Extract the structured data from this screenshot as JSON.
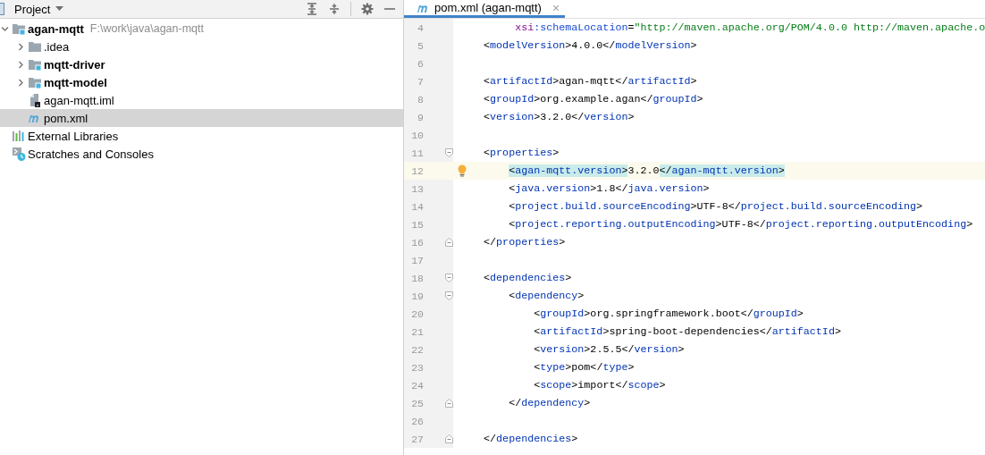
{
  "project_panel": {
    "title": "Project"
  },
  "tree": [
    {
      "kind": "module",
      "label": "agan-mqtt",
      "path": "F:\\work\\java\\agan-mqtt",
      "expanded": true,
      "selected": false,
      "children": [
        {
          "kind": "folder",
          "label": ".idea",
          "expanded": false,
          "selected": false
        },
        {
          "kind": "module-folder",
          "label": "mqtt-driver",
          "expanded": false,
          "selected": false
        },
        {
          "kind": "module-folder",
          "label": "mqtt-model",
          "expanded": false,
          "selected": false
        },
        {
          "kind": "iml",
          "label": "agan-mqtt.iml",
          "selected": false
        },
        {
          "kind": "maven",
          "label": "pom.xml",
          "selected": true
        }
      ]
    },
    {
      "kind": "libraries",
      "label": "External Libraries",
      "selected": false
    },
    {
      "kind": "scratches",
      "label": "Scratches and Consoles",
      "selected": false
    }
  ],
  "tabs": [
    {
      "label": "pom.xml (agan-mqtt)",
      "close": "×",
      "selected": true
    }
  ],
  "editor": {
    "lines": [
      {
        "number": "4",
        "kind": "continuation",
        "current": false,
        "intention": false,
        "tokens": [
          {
            "kind": "ns",
            "text": "xsi"
          },
          {
            "kind": "attr",
            "text": ":schemaLocation"
          },
          {
            "kind": "plain",
            "text": "="
          },
          {
            "kind": "string",
            "text": "\"http://maven.apache.org/POM/4.0.0 http://maven.apache.o"
          }
        ]
      },
      {
        "number": "5",
        "kind": "plain",
        "current": false,
        "intention": false,
        "tokens": [
          {
            "kind": "plain",
            "text": "<"
          },
          {
            "kind": "tag",
            "text": "modelVersion"
          },
          {
            "kind": "plain",
            "text": ">4.0.0</"
          },
          {
            "kind": "tag",
            "text": "modelVersion"
          },
          {
            "kind": "plain",
            "text": ">"
          }
        ]
      },
      {
        "number": "6",
        "kind": "plain",
        "current": false,
        "intention": false
      },
      {
        "number": "7",
        "kind": "plain",
        "current": false,
        "intention": false,
        "tokens": [
          {
            "kind": "plain",
            "text": "<"
          },
          {
            "kind": "tag",
            "text": "artifactId"
          },
          {
            "kind": "plain",
            "text": ">agan-mqtt</"
          },
          {
            "kind": "tag",
            "text": "artifactId"
          },
          {
            "kind": "plain",
            "text": ">"
          }
        ]
      },
      {
        "number": "8",
        "kind": "plain",
        "current": false,
        "intention": false,
        "tokens": [
          {
            "kind": "plain",
            "text": "<"
          },
          {
            "kind": "tag",
            "text": "groupId"
          },
          {
            "kind": "plain",
            "text": ">org.example.agan</"
          },
          {
            "kind": "tag",
            "text": "groupId"
          },
          {
            "kind": "plain",
            "text": ">"
          }
        ]
      },
      {
        "number": "9",
        "kind": "plain",
        "current": false,
        "intention": false,
        "tokens": [
          {
            "kind": "plain",
            "text": "<"
          },
          {
            "kind": "tag",
            "text": "version"
          },
          {
            "kind": "plain",
            "text": ">3.2.0</"
          },
          {
            "kind": "tag",
            "text": "version"
          },
          {
            "kind": "plain",
            "text": ">"
          }
        ]
      },
      {
        "number": "10",
        "kind": "plain",
        "current": false,
        "intention": false
      },
      {
        "number": "11",
        "kind": "fold-start",
        "current": false,
        "intention": false,
        "tokens": [
          {
            "kind": "plain",
            "text": "<"
          },
          {
            "kind": "tag",
            "text": "properties"
          },
          {
            "kind": "plain",
            "text": ">"
          }
        ],
        "children": [
          {
            "number": "12",
            "kind": "plain",
            "current": true,
            "intention": true,
            "tokens": [
              {
                "kind": "match-plain",
                "text": "<"
              },
              {
                "kind": "match-tag",
                "text": "agan-mqtt.version"
              },
              {
                "kind": "match-plain",
                "text": ">"
              },
              {
                "kind": "plain",
                "text": "3.2.0"
              },
              {
                "kind": "match-plain",
                "text": "</"
              },
              {
                "kind": "match-tag",
                "text": "agan-mqtt.version"
              },
              {
                "kind": "match-plain",
                "text": ">"
              }
            ]
          },
          {
            "number": "13",
            "kind": "plain",
            "current": false,
            "intention": false,
            "tokens": [
              {
                "kind": "plain",
                "text": "<"
              },
              {
                "kind": "tag",
                "text": "java.version"
              },
              {
                "kind": "plain",
                "text": ">1.8</"
              },
              {
                "kind": "tag",
                "text": "java.version"
              },
              {
                "kind": "plain",
                "text": ">"
              }
            ]
          },
          {
            "number": "14",
            "kind": "plain",
            "current": false,
            "intention": false,
            "tokens": [
              {
                "kind": "plain",
                "text": "<"
              },
              {
                "kind": "tag",
                "text": "project.build.sourceEncoding"
              },
              {
                "kind": "plain",
                "text": ">UTF-8</"
              },
              {
                "kind": "tag",
                "text": "project.build.sourceEncoding"
              },
              {
                "kind": "plain",
                "text": ">"
              }
            ]
          },
          {
            "number": "15",
            "kind": "plain",
            "current": false,
            "intention": false,
            "tokens": [
              {
                "kind": "plain",
                "text": "<"
              },
              {
                "kind": "tag",
                "text": "project.reporting.outputEncoding"
              },
              {
                "kind": "plain",
                "text": ">UTF-8</"
              },
              {
                "kind": "tag",
                "text": "project.reporting.outputEncoding"
              },
              {
                "kind": "plain",
                "text": ">"
              }
            ]
          }
        ]
      },
      {
        "number": "16",
        "kind": "fold-end",
        "current": false,
        "intention": false,
        "tokens": [
          {
            "kind": "plain",
            "text": "</"
          },
          {
            "kind": "tag",
            "text": "properties"
          },
          {
            "kind": "plain",
            "text": ">"
          }
        ]
      },
      {
        "number": "17",
        "kind": "plain",
        "current": false,
        "intention": false
      },
      {
        "number": "18",
        "kind": "fold-start",
        "current": false,
        "intention": false,
        "tokens": [
          {
            "kind": "plain",
            "text": "<"
          },
          {
            "kind": "tag",
            "text": "dependencies"
          },
          {
            "kind": "plain",
            "text": ">"
          }
        ],
        "children": [
          {
            "number": "19",
            "kind": "fold-start",
            "current": false,
            "intention": false,
            "tokens": [
              {
                "kind": "plain",
                "text": "<"
              },
              {
                "kind": "tag",
                "text": "dependency"
              },
              {
                "kind": "plain",
                "text": ">"
              }
            ],
            "children": [
              {
                "number": "20",
                "kind": "plain",
                "current": false,
                "intention": false,
                "tokens": [
                  {
                    "kind": "plain",
                    "text": "<"
                  },
                  {
                    "kind": "tag",
                    "text": "groupId"
                  },
                  {
                    "kind": "plain",
                    "text": ">org.springframework.boot</"
                  },
                  {
                    "kind": "tag",
                    "text": "groupId"
                  },
                  {
                    "kind": "plain",
                    "text": ">"
                  }
                ]
              },
              {
                "number": "21",
                "kind": "plain",
                "current": false,
                "intention": false,
                "tokens": [
                  {
                    "kind": "plain",
                    "text": "<"
                  },
                  {
                    "kind": "tag",
                    "text": "artifactId"
                  },
                  {
                    "kind": "plain",
                    "text": ">spring-boot-dependencies</"
                  },
                  {
                    "kind": "tag",
                    "text": "artifactId"
                  },
                  {
                    "kind": "plain",
                    "text": ">"
                  }
                ]
              },
              {
                "number": "22",
                "kind": "plain",
                "current": false,
                "intention": false,
                "tokens": [
                  {
                    "kind": "plain",
                    "text": "<"
                  },
                  {
                    "kind": "tag",
                    "text": "version"
                  },
                  {
                    "kind": "plain",
                    "text": ">2.5.5</"
                  },
                  {
                    "kind": "tag",
                    "text": "version"
                  },
                  {
                    "kind": "plain",
                    "text": ">"
                  }
                ]
              },
              {
                "number": "23",
                "kind": "plain",
                "current": false,
                "intention": false,
                "tokens": [
                  {
                    "kind": "plain",
                    "text": "<"
                  },
                  {
                    "kind": "tag",
                    "text": "type"
                  },
                  {
                    "kind": "plain",
                    "text": ">pom</"
                  },
                  {
                    "kind": "tag",
                    "text": "type"
                  },
                  {
                    "kind": "plain",
                    "text": ">"
                  }
                ]
              },
              {
                "number": "24",
                "kind": "plain",
                "current": false,
                "intention": false,
                "tokens": [
                  {
                    "kind": "plain",
                    "text": "<"
                  },
                  {
                    "kind": "tag",
                    "text": "scope"
                  },
                  {
                    "kind": "plain",
                    "text": ">import</"
                  },
                  {
                    "kind": "tag",
                    "text": "scope"
                  },
                  {
                    "kind": "plain",
                    "text": ">"
                  }
                ]
              }
            ]
          },
          {
            "number": "25",
            "kind": "fold-end",
            "current": false,
            "intention": false,
            "tokens": [
              {
                "kind": "plain",
                "text": "</"
              },
              {
                "kind": "tag",
                "text": "dependency"
              },
              {
                "kind": "plain",
                "text": ">"
              }
            ]
          },
          {
            "number": "26",
            "kind": "plain",
            "current": false,
            "intention": false
          }
        ]
      },
      {
        "number": "27",
        "kind": "fold-end",
        "current": false,
        "intention": false,
        "tokens": [
          {
            "kind": "plain",
            "text": "</"
          },
          {
            "kind": "tag",
            "text": "dependencies"
          },
          {
            "kind": "plain",
            "text": ">"
          }
        ]
      }
    ]
  }
}
